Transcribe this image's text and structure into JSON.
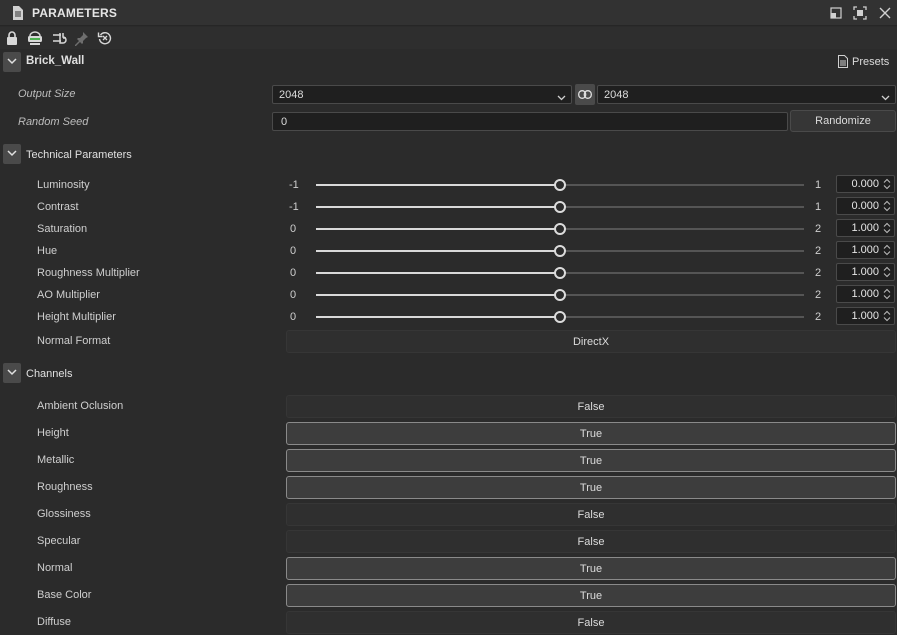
{
  "window": {
    "title": "PARAMETERS"
  },
  "graph": {
    "name": "Brick_Wall",
    "presets_label": "Presets"
  },
  "output_size": {
    "label": "Output Size",
    "width_value": "2048",
    "height_value": "2048"
  },
  "random_seed": {
    "label": "Random Seed",
    "value": "0",
    "randomize_label": "Randomize"
  },
  "technical": {
    "title": "Technical Parameters",
    "sliders": [
      {
        "label": "Luminosity",
        "min": "-1",
        "max": "1",
        "value": "0.000",
        "fraction": 0.5
      },
      {
        "label": "Contrast",
        "min": "-1",
        "max": "1",
        "value": "0.000",
        "fraction": 0.5
      },
      {
        "label": "Saturation",
        "min": "0",
        "max": "2",
        "value": "1.000",
        "fraction": 0.5
      },
      {
        "label": "Hue",
        "min": "0",
        "max": "2",
        "value": "1.000",
        "fraction": 0.5
      },
      {
        "label": "Roughness Multiplier",
        "min": "0",
        "max": "2",
        "value": "1.000",
        "fraction": 0.5
      },
      {
        "label": "AO Multiplier",
        "min": "0",
        "max": "2",
        "value": "1.000",
        "fraction": 0.5
      },
      {
        "label": "Height Multiplier",
        "min": "0",
        "max": "2",
        "value": "1.000",
        "fraction": 0.5
      }
    ],
    "normal_format": {
      "label": "Normal Format",
      "value": "DirectX"
    }
  },
  "channels": {
    "title": "Channels",
    "items": [
      {
        "label": "Ambient Oclusion",
        "value": "False",
        "on": false
      },
      {
        "label": "Height",
        "value": "True",
        "on": true
      },
      {
        "label": "Metallic",
        "value": "True",
        "on": true
      },
      {
        "label": "Roughness",
        "value": "True",
        "on": true
      },
      {
        "label": "Glossiness",
        "value": "False",
        "on": false
      },
      {
        "label": "Specular",
        "value": "False",
        "on": false
      },
      {
        "label": "Normal",
        "value": "True",
        "on": true
      },
      {
        "label": "Base Color",
        "value": "True",
        "on": true
      },
      {
        "label": "Diffuse",
        "value": "False",
        "on": false
      }
    ]
  },
  "toolbar_icons": [
    "lock-icon",
    "node-output-icon",
    "plug-icon",
    "pin-icon",
    "reset-icon"
  ],
  "colors": {
    "panel_bg": "#2b2b2b",
    "title_bg": "#323232",
    "toggle_on_border": "#8a8a8a"
  }
}
